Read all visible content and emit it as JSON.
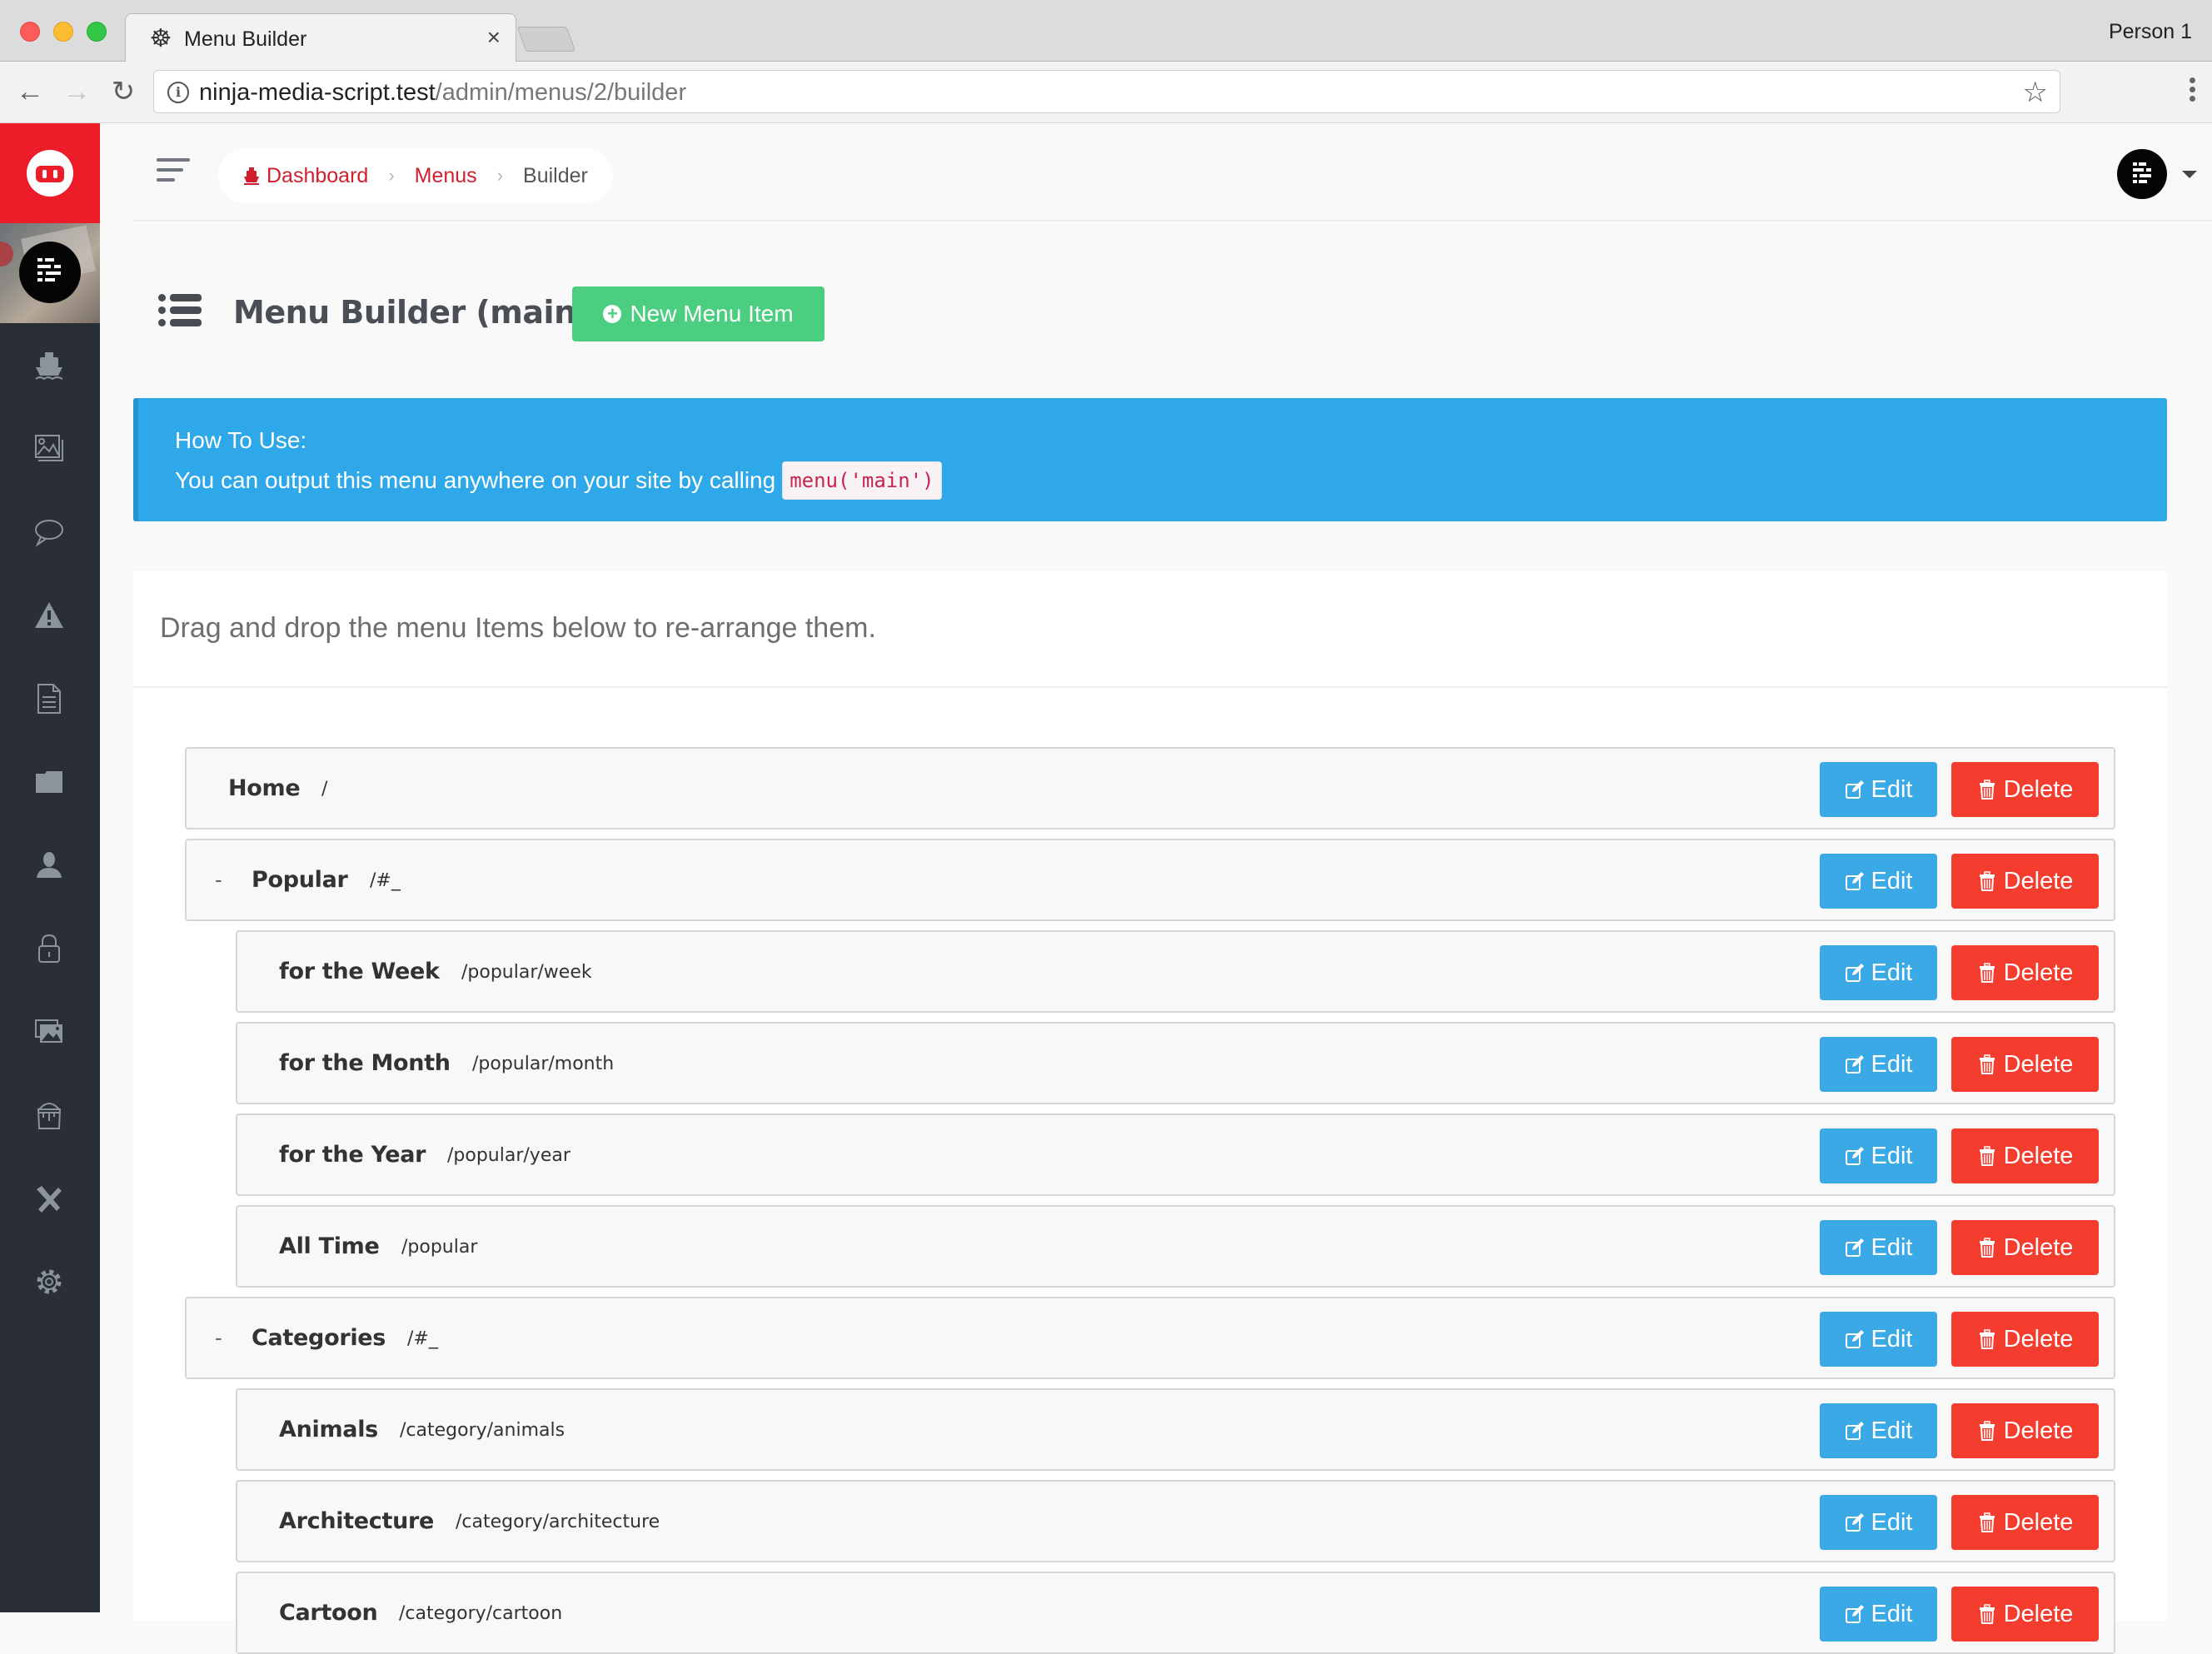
{
  "browser": {
    "tab_title": "Menu Builder",
    "tab_icon": "helm-icon",
    "profile": "Person 1",
    "url_host": "ninja-media-script.test",
    "url_path": "/admin/menus/2/builder"
  },
  "sidebar": {
    "logo": "ninja-mask-logo",
    "items": [
      {
        "name": "dashboard",
        "icon": "ship-icon"
      },
      {
        "name": "media",
        "icon": "image-icon"
      },
      {
        "name": "comments",
        "icon": "chat-bubble-icon"
      },
      {
        "name": "reports",
        "icon": "warning-icon"
      },
      {
        "name": "pages",
        "icon": "document-icon"
      },
      {
        "name": "categories",
        "icon": "folder-icon"
      },
      {
        "name": "users",
        "icon": "user-icon"
      },
      {
        "name": "roles",
        "icon": "lock-icon"
      },
      {
        "name": "gallery",
        "icon": "photos-icon"
      },
      {
        "name": "themes",
        "icon": "paint-bucket-icon"
      },
      {
        "name": "tools",
        "icon": "tools-icon"
      },
      {
        "name": "settings",
        "icon": "gear-icon"
      }
    ]
  },
  "breadcrumb": {
    "items": [
      {
        "label": "Dashboard"
      },
      {
        "label": "Menus"
      },
      {
        "label": "Builder"
      }
    ]
  },
  "page": {
    "title": "Menu Builder (main)",
    "new_button": "New Menu Item"
  },
  "info": {
    "title": "How To Use:",
    "text": "You can output this menu anywhere on your site by calling",
    "code": "menu('main')"
  },
  "panel": {
    "heading": "Drag and drop the menu Items below to re-arrange them."
  },
  "actions": {
    "edit": "Edit",
    "delete": "Delete"
  },
  "menu_items": [
    {
      "label": "Home",
      "url": "/",
      "level": 0,
      "toggle": ""
    },
    {
      "label": "Popular",
      "url": "/#_",
      "level": 0,
      "toggle": "-"
    },
    {
      "label": "for the Week",
      "url": "/popular/week",
      "level": 1,
      "toggle": ""
    },
    {
      "label": "for the Month",
      "url": "/popular/month",
      "level": 1,
      "toggle": ""
    },
    {
      "label": "for the Year",
      "url": "/popular/year",
      "level": 1,
      "toggle": ""
    },
    {
      "label": "All Time",
      "url": "/popular",
      "level": 1,
      "toggle": ""
    },
    {
      "label": "Categories",
      "url": "/#_",
      "level": 0,
      "toggle": "-"
    },
    {
      "label": "Animals",
      "url": "/category/animals",
      "level": 1,
      "toggle": ""
    },
    {
      "label": "Architecture",
      "url": "/category/architecture",
      "level": 1,
      "toggle": ""
    },
    {
      "label": "Cartoon",
      "url": "/category/cartoon",
      "level": 1,
      "toggle": ""
    }
  ]
}
